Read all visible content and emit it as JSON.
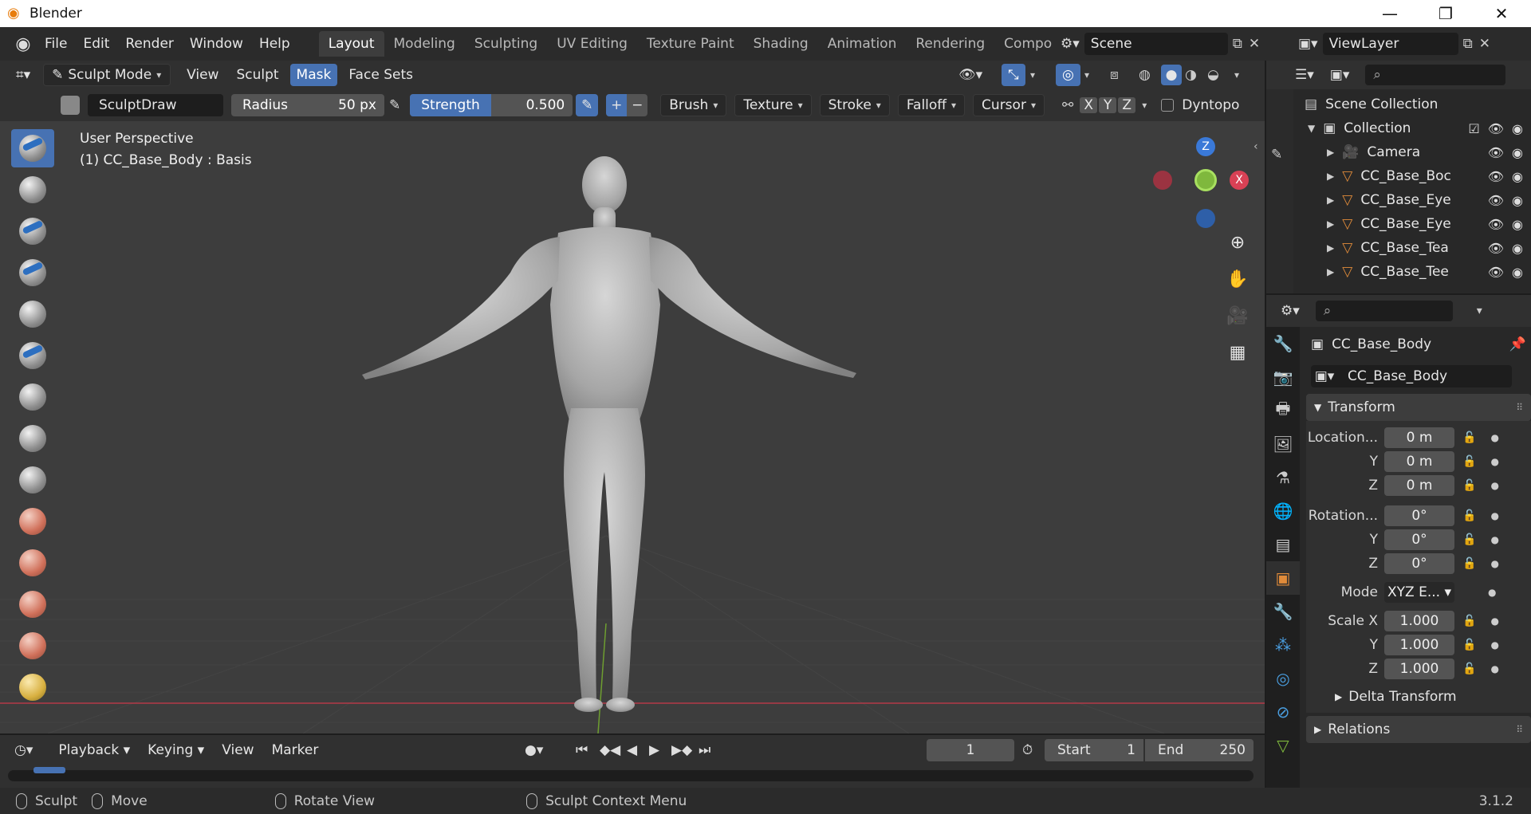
{
  "window": {
    "title": "Blender"
  },
  "menus": [
    "File",
    "Edit",
    "Render",
    "Window",
    "Help"
  ],
  "workspaces": [
    {
      "label": "Layout",
      "active": true
    },
    {
      "label": "Modeling",
      "active": false
    },
    {
      "label": "Sculpting",
      "active": false
    },
    {
      "label": "UV Editing",
      "active": false
    },
    {
      "label": "Texture Paint",
      "active": false
    },
    {
      "label": "Shading",
      "active": false
    },
    {
      "label": "Animation",
      "active": false
    },
    {
      "label": "Rendering",
      "active": false
    },
    {
      "label": "Compo",
      "active": false
    }
  ],
  "scene": {
    "name": "Scene"
  },
  "view_layer": {
    "name": "ViewLayer"
  },
  "viewport_header": {
    "mode": "Sculpt Mode",
    "menus": [
      "View",
      "Sculpt",
      "Mask",
      "Face Sets"
    ],
    "active_menu": "Mask"
  },
  "tool_settings": {
    "brush_name": "SculptDraw",
    "radius_label": "Radius",
    "radius_value": "50 px",
    "strength_label": "Strength",
    "strength_value": "0.500",
    "strength_fraction": 0.5,
    "add": "+",
    "subtract": "−",
    "dropdowns": [
      "Brush",
      "Texture",
      "Stroke",
      "Falloff",
      "Cursor"
    ],
    "symmetry": [
      "X",
      "Y",
      "Z"
    ],
    "dyntopo": "Dyntopo"
  },
  "viewport": {
    "perspective": "User Perspective",
    "object_info": "(1) CC_Base_Body : Basis",
    "gizmo": {
      "z": "Z",
      "x": "X"
    }
  },
  "outliner": {
    "root": "Scene Collection",
    "collection": "Collection",
    "items": [
      {
        "name": "Camera",
        "icon": "camera-icon"
      },
      {
        "name": "CC_Base_Boc",
        "icon": "mesh-icon"
      },
      {
        "name": "CC_Base_Eye",
        "icon": "mesh-icon"
      },
      {
        "name": "CC_Base_Eye",
        "icon": "mesh-icon"
      },
      {
        "name": "CC_Base_Tea",
        "icon": "mesh-icon"
      },
      {
        "name": "CC_Base_Tee",
        "icon": "mesh-icon"
      }
    ]
  },
  "properties": {
    "object_name": "CC_Base_Body",
    "object_field": "CC_Base_Body",
    "transform_title": "Transform",
    "location_label": "Location...",
    "location": [
      "0 m",
      "0 m",
      "0 m"
    ],
    "rotation_label": "Rotation...",
    "rotation": [
      "0°",
      "0°",
      "0°"
    ],
    "mode_label": "Mode",
    "mode_value": "XYZ E...",
    "scale_label": "Scale X",
    "scale": [
      "1.000",
      "1.000",
      "1.000"
    ],
    "axis_y": "Y",
    "axis_z": "Z",
    "delta_transform": "Delta Transform",
    "relations": "Relations"
  },
  "timeline": {
    "menus": [
      "Playback",
      "Keying",
      "View",
      "Marker"
    ],
    "current_frame": "1",
    "start_label": "Start",
    "start_value": "1",
    "end_label": "End",
    "end_value": "250"
  },
  "statusbar": {
    "left_action": "Sculpt",
    "middle_action": "Move",
    "rotate_action": "Rotate View",
    "right_action": "Sculpt Context Menu",
    "version": "3.1.2"
  },
  "colors": {
    "accent": "#4772b3",
    "viewport_bg": "#3d3d3d",
    "x_axis": "#d94155",
    "y_axis": "#7fb83d",
    "z_axis": "#3a79d8"
  }
}
